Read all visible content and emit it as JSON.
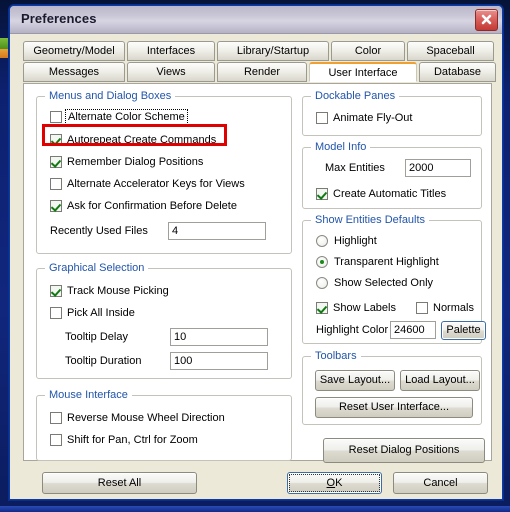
{
  "window": {
    "title": "Preferences",
    "close_icon": "close-icon"
  },
  "tabs": {
    "row1": [
      {
        "label": "Geometry/Model",
        "active": false
      },
      {
        "label": "Interfaces",
        "active": false
      },
      {
        "label": "Library/Startup",
        "active": false
      },
      {
        "label": "Color",
        "active": false
      },
      {
        "label": "Spaceball",
        "active": false
      }
    ],
    "row2": [
      {
        "label": "Messages",
        "active": false
      },
      {
        "label": "Views",
        "active": false
      },
      {
        "label": "Render",
        "active": false
      },
      {
        "label": "User Interface",
        "active": true
      },
      {
        "label": "Database",
        "active": false
      }
    ],
    "active_tab": "User Interface",
    "active_accent_color": "#f0a030"
  },
  "annotation": {
    "highlight_color": "#e00000",
    "target": "Autorepeat Create Commands"
  },
  "groups": {
    "menus_and_dialog_boxes": {
      "legend": "Menus and Dialog Boxes",
      "checkboxes": [
        {
          "label": "Alternate Color Scheme",
          "checked": false,
          "focused": true
        },
        {
          "label": "Autorepeat Create Commands",
          "checked": true,
          "accel": "A",
          "highlighted": true
        },
        {
          "label": "Remember Dialog Positions",
          "checked": true
        },
        {
          "label": "Alternate Accelerator Keys for Views",
          "checked": false
        },
        {
          "label": "Ask for Confirmation Before Delete",
          "checked": true
        }
      ],
      "field": {
        "label": "Recently Used Files",
        "value": "4"
      }
    },
    "graphical_selection": {
      "legend": "Graphical Selection",
      "checkboxes": [
        {
          "label": "Track Mouse Picking",
          "checked": true
        },
        {
          "label": "Pick All Inside",
          "checked": false
        }
      ],
      "fields": [
        {
          "label": "Tooltip Delay",
          "value": "10"
        },
        {
          "label": "Tooltip Duration",
          "value": "100"
        }
      ]
    },
    "mouse_interface": {
      "legend": "Mouse Interface",
      "checkboxes": [
        {
          "label": "Reverse Mouse Wheel Direction",
          "checked": false
        },
        {
          "label": "Shift for Pan, Ctrl for Zoom",
          "checked": false
        }
      ]
    },
    "dockable_panes": {
      "legend": "Dockable Panes",
      "checkboxes": [
        {
          "label": "Animate Fly-Out",
          "checked": false
        }
      ]
    },
    "model_info": {
      "legend": "Model Info",
      "field": {
        "label": "Max Entities",
        "value": "2000"
      },
      "checkboxes": [
        {
          "label": "Create Automatic Titles",
          "checked": true
        }
      ]
    },
    "show_entities_defaults": {
      "legend": "Show Entities Defaults",
      "radios": [
        {
          "label": "Highlight",
          "checked": false
        },
        {
          "label": "Transparent Highlight",
          "checked": true
        },
        {
          "label": "Show Selected Only",
          "checked": false
        }
      ],
      "checkboxes": [
        {
          "label": "Show Labels",
          "checked": true
        },
        {
          "label": "Normals",
          "checked": false
        }
      ],
      "color_field": {
        "label": "Highlight Color",
        "value": "24600",
        "button": "Palette"
      }
    },
    "toolbars": {
      "legend": "Toolbars",
      "buttons": [
        {
          "label": "Save Layout..."
        },
        {
          "label": "Load Layout..."
        },
        {
          "label": "Reset User Interface..."
        }
      ]
    },
    "reset_dialog_positions": {
      "label": "Reset Dialog Positions"
    }
  },
  "footer": {
    "reset_all": "Reset All",
    "ok": "OK",
    "ok_accel": "O",
    "cancel": "Cancel"
  }
}
